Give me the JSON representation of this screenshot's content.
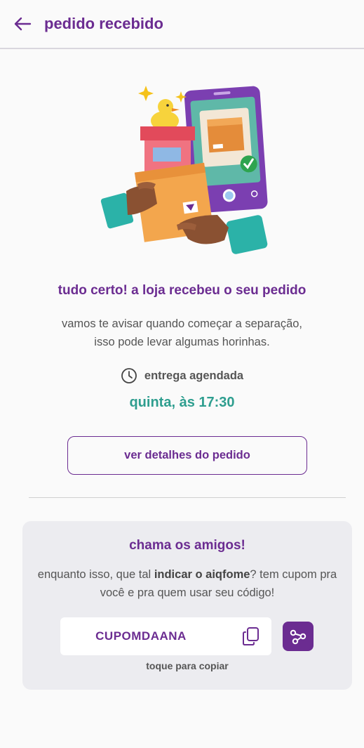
{
  "header": {
    "title": "pedido recebido",
    "back_icon": "arrow-left-icon"
  },
  "status": {
    "headline": "tudo certo! a loja recebeu o seu pedido",
    "line1": "vamos te avisar quando começar a separação,",
    "line2": "isso pode levar algumas horinhas."
  },
  "schedule": {
    "icon": "clock-icon",
    "label": "entrega agendada",
    "time": "quinta, às 17:30"
  },
  "actions": {
    "details_label": "ver detalhes do pedido"
  },
  "referral": {
    "title": "chama os amigos!",
    "text_before": "enquanto isso, que tal ",
    "text_bold": "indicar o aiqfome",
    "text_after": "? tem cupom pra você e pra quem usar seu código!",
    "coupon_code": "CUPOMDAANA",
    "copy_hint": "toque para copiar",
    "copy_icon": "copy-icon",
    "share_icon": "share-icon"
  },
  "colors": {
    "brand_purple": "#6b2c91",
    "accent_teal": "#2e9e8f",
    "background": "#fafafa",
    "card_background": "#ececf0"
  }
}
